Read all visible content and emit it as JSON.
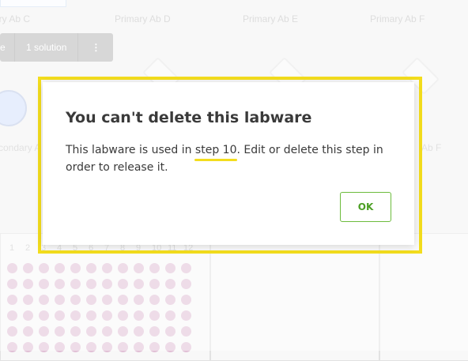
{
  "slots": {
    "top": [
      "ary Ab C",
      "Primary Ab D",
      "Primary Ab E",
      "Primary Ab F"
    ],
    "middle_left": "condary A",
    "middle_right": "Ab F"
  },
  "toolbar": {
    "cut_label": "e",
    "solutions_label": "1 solution",
    "more_label": "⋮"
  },
  "plate": {
    "column_numbers": [
      "1",
      "2",
      "3",
      "4",
      "5",
      "6",
      "7",
      "8",
      "9",
      "10",
      "11",
      "12"
    ],
    "well_color": "#e1c0d6"
  },
  "dialog": {
    "title": "You can't delete this labware",
    "message_before": "This labware is used in ",
    "step_link": "step 10",
    "message_after": ". Edit or delete this step in order to release it.",
    "ok_label": "OK"
  },
  "colors": {
    "highlight": "#f3dd1d",
    "ok_border": "#6cbb3c",
    "ok_text": "#4c9f24"
  }
}
